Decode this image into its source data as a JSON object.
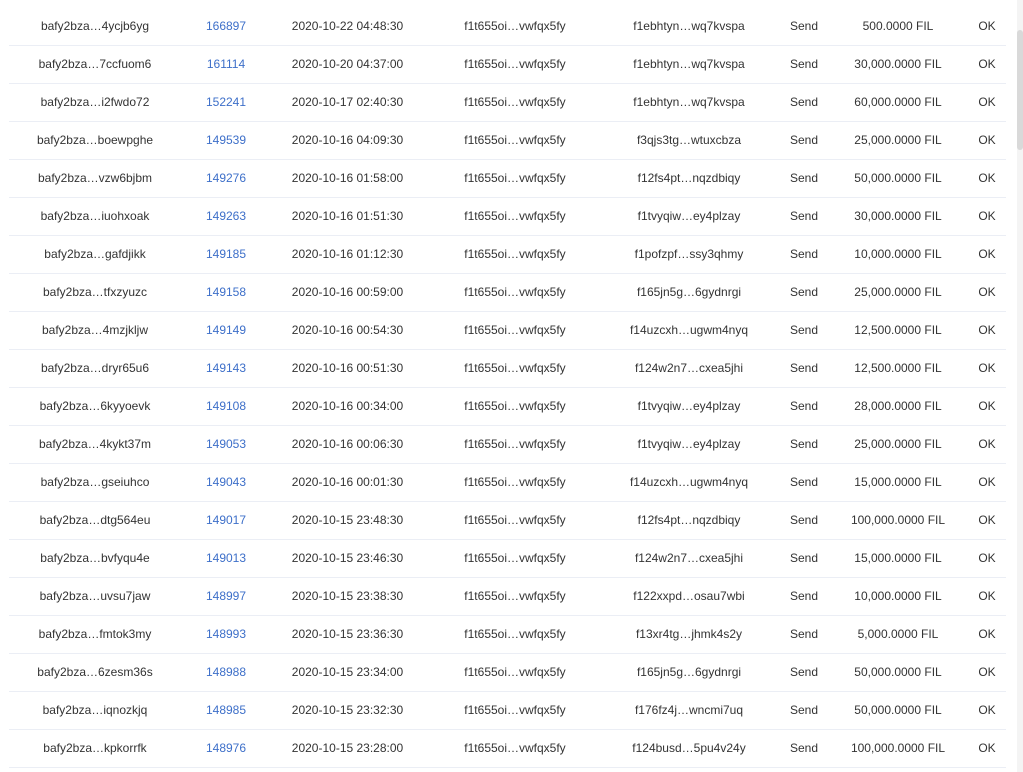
{
  "messages": {
    "rows": [
      {
        "cid": "bafy2bza…4ycjb6yg",
        "height": "166897",
        "time": "2020-10-22 04:48:30",
        "from": "f1t655oi…vwfqx5fy",
        "to": "f1ebhtyn…wq7kvspa",
        "method": "Send",
        "value": "500.0000 FIL",
        "status": "OK"
      },
      {
        "cid": "bafy2bza…7ccfuom6",
        "height": "161114",
        "time": "2020-10-20 04:37:00",
        "from": "f1t655oi…vwfqx5fy",
        "to": "f1ebhtyn…wq7kvspa",
        "method": "Send",
        "value": "30,000.0000 FIL",
        "status": "OK"
      },
      {
        "cid": "bafy2bza…i2fwdo72",
        "height": "152241",
        "time": "2020-10-17 02:40:30",
        "from": "f1t655oi…vwfqx5fy",
        "to": "f1ebhtyn…wq7kvspa",
        "method": "Send",
        "value": "60,000.0000 FIL",
        "status": "OK"
      },
      {
        "cid": "bafy2bza…boewpghe",
        "height": "149539",
        "time": "2020-10-16 04:09:30",
        "from": "f1t655oi…vwfqx5fy",
        "to": "f3qjs3tg…wtuxcbza",
        "method": "Send",
        "value": "25,000.0000 FIL",
        "status": "OK"
      },
      {
        "cid": "bafy2bza…vzw6bjbm",
        "height": "149276",
        "time": "2020-10-16 01:58:00",
        "from": "f1t655oi…vwfqx5fy",
        "to": "f12fs4pt…nqzdbiqy",
        "method": "Send",
        "value": "50,000.0000 FIL",
        "status": "OK"
      },
      {
        "cid": "bafy2bza…iuohxoak",
        "height": "149263",
        "time": "2020-10-16 01:51:30",
        "from": "f1t655oi…vwfqx5fy",
        "to": "f1tvyqiw…ey4plzay",
        "method": "Send",
        "value": "30,000.0000 FIL",
        "status": "OK"
      },
      {
        "cid": "bafy2bza…gafdjikk",
        "height": "149185",
        "time": "2020-10-16 01:12:30",
        "from": "f1t655oi…vwfqx5fy",
        "to": "f1pofzpf…ssy3qhmy",
        "method": "Send",
        "value": "10,000.0000 FIL",
        "status": "OK"
      },
      {
        "cid": "bafy2bza…tfxzyuzc",
        "height": "149158",
        "time": "2020-10-16 00:59:00",
        "from": "f1t655oi…vwfqx5fy",
        "to": "f165jn5g…6gydnrgi",
        "method": "Send",
        "value": "25,000.0000 FIL",
        "status": "OK"
      },
      {
        "cid": "bafy2bza…4mzjkljw",
        "height": "149149",
        "time": "2020-10-16 00:54:30",
        "from": "f1t655oi…vwfqx5fy",
        "to": "f14uzcxh…ugwm4nyq",
        "method": "Send",
        "value": "12,500.0000 FIL",
        "status": "OK"
      },
      {
        "cid": "bafy2bza…dryr65u6",
        "height": "149143",
        "time": "2020-10-16 00:51:30",
        "from": "f1t655oi…vwfqx5fy",
        "to": "f124w2n7…cxea5jhi",
        "method": "Send",
        "value": "12,500.0000 FIL",
        "status": "OK"
      },
      {
        "cid": "bafy2bza…6kyyoevk",
        "height": "149108",
        "time": "2020-10-16 00:34:00",
        "from": "f1t655oi…vwfqx5fy",
        "to": "f1tvyqiw…ey4plzay",
        "method": "Send",
        "value": "28,000.0000 FIL",
        "status": "OK"
      },
      {
        "cid": "bafy2bza…4kykt37m",
        "height": "149053",
        "time": "2020-10-16 00:06:30",
        "from": "f1t655oi…vwfqx5fy",
        "to": "f1tvyqiw…ey4plzay",
        "method": "Send",
        "value": "25,000.0000 FIL",
        "status": "OK"
      },
      {
        "cid": "bafy2bza…gseiuhco",
        "height": "149043",
        "time": "2020-10-16 00:01:30",
        "from": "f1t655oi…vwfqx5fy",
        "to": "f14uzcxh…ugwm4nyq",
        "method": "Send",
        "value": "15,000.0000 FIL",
        "status": "OK"
      },
      {
        "cid": "bafy2bza…dtg564eu",
        "height": "149017",
        "time": "2020-10-15 23:48:30",
        "from": "f1t655oi…vwfqx5fy",
        "to": "f12fs4pt…nqzdbiqy",
        "method": "Send",
        "value": "100,000.0000 FIL",
        "status": "OK"
      },
      {
        "cid": "bafy2bza…bvfyqu4e",
        "height": "149013",
        "time": "2020-10-15 23:46:30",
        "from": "f1t655oi…vwfqx5fy",
        "to": "f124w2n7…cxea5jhi",
        "method": "Send",
        "value": "15,000.0000 FIL",
        "status": "OK"
      },
      {
        "cid": "bafy2bza…uvsu7jaw",
        "height": "148997",
        "time": "2020-10-15 23:38:30",
        "from": "f1t655oi…vwfqx5fy",
        "to": "f122xxpd…osau7wbi",
        "method": "Send",
        "value": "10,000.0000 FIL",
        "status": "OK"
      },
      {
        "cid": "bafy2bza…fmtok3my",
        "height": "148993",
        "time": "2020-10-15 23:36:30",
        "from": "f1t655oi…vwfqx5fy",
        "to": "f13xr4tg…jhmk4s2y",
        "method": "Send",
        "value": "5,000.0000 FIL",
        "status": "OK"
      },
      {
        "cid": "bafy2bza…6zesm36s",
        "height": "148988",
        "time": "2020-10-15 23:34:00",
        "from": "f1t655oi…vwfqx5fy",
        "to": "f165jn5g…6gydnrgi",
        "method": "Send",
        "value": "50,000.0000 FIL",
        "status": "OK"
      },
      {
        "cid": "bafy2bza…iqnozkjq",
        "height": "148985",
        "time": "2020-10-15 23:32:30",
        "from": "f1t655oi…vwfqx5fy",
        "to": "f176fz4j…wncmi7uq",
        "method": "Send",
        "value": "50,000.0000 FIL",
        "status": "OK"
      },
      {
        "cid": "bafy2bza…kpkorrfk",
        "height": "148976",
        "time": "2020-10-15 23:28:00",
        "from": "f1t655oi…vwfqx5fy",
        "to": "f124busd…5pu4v24y",
        "method": "Send",
        "value": "100,000.0000 FIL",
        "status": "OK"
      }
    ]
  },
  "colors": {
    "link": "#3d6fc9",
    "text": "#333333",
    "row_border": "#ebeef5"
  }
}
